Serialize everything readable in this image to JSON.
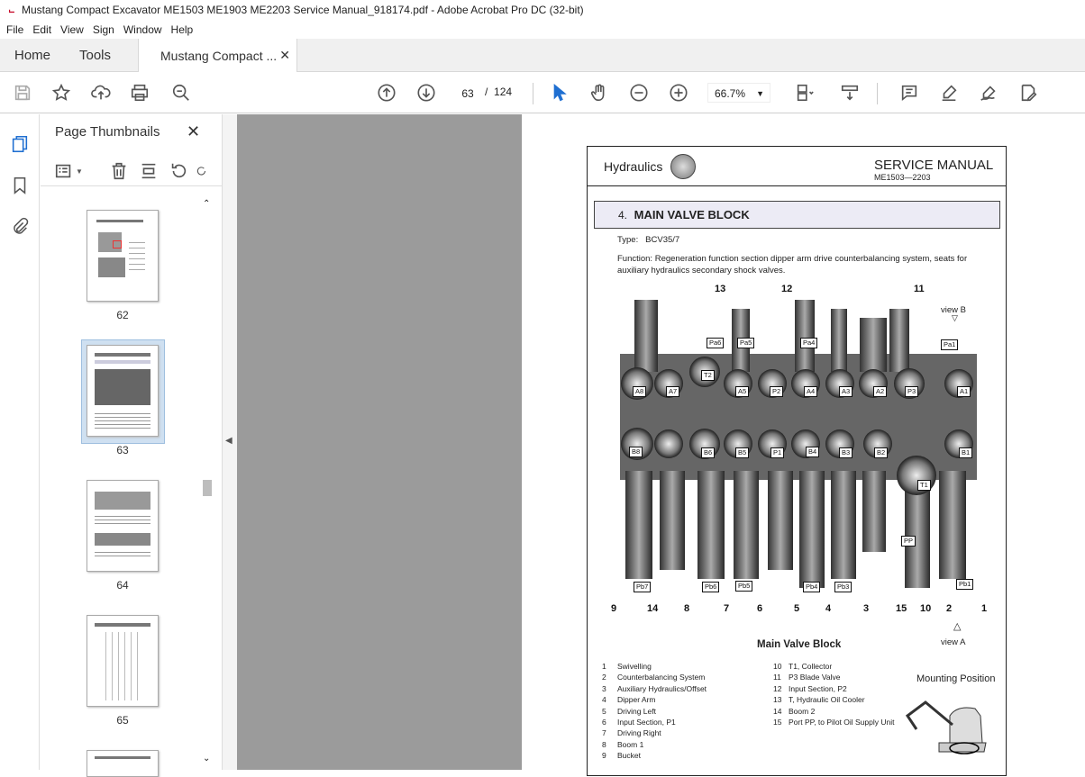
{
  "window": {
    "title": "Mustang Compact Excavator ME1503 ME1903 ME2203 Service Manual_918174.pdf - Adobe Acrobat Pro DC (32-bit)"
  },
  "menu": [
    "File",
    "Edit",
    "View",
    "Sign",
    "Window",
    "Help"
  ],
  "tabs": {
    "home": "Home",
    "tools": "Tools",
    "doc": "Mustang Compact ..."
  },
  "toolbar": {
    "page_current": "63",
    "page_sep": "/",
    "page_total": "124",
    "zoom": "66.7%"
  },
  "thumbnails": {
    "title": "Page Thumbnails",
    "pages": [
      {
        "label": "62"
      },
      {
        "label": "63"
      },
      {
        "label": "64"
      },
      {
        "label": "65"
      }
    ]
  },
  "doc": {
    "header_left": "Hydraulics",
    "header_right": "SERVICE MANUAL",
    "header_sub": "ME1503—2203",
    "section_num": "4.",
    "section_title": "MAIN VALVE BLOCK",
    "type_label": "Type:",
    "type_value": "BCV35/7",
    "function_text": "Function: Regeneration function section dipper arm drive counterbalancing system, seats for auxiliary hydraulics secondary shock valves.",
    "figure_caption": "Main Valve Block",
    "view_a": "view A",
    "view_b": "view B",
    "mounting": "Mounting Position",
    "top_callouts": [
      "13",
      "12",
      "11"
    ],
    "bottom_callouts": [
      "9",
      "14",
      "8",
      "7",
      "6",
      "5",
      "4",
      "3",
      "15",
      "10",
      "2",
      "1"
    ],
    "port_labels_top": [
      "Pa6",
      "Pa5",
      "Pa4",
      "Pa1"
    ],
    "port_labels_row1": [
      "A8",
      "A7",
      "T2",
      "A5",
      "P2",
      "A4",
      "A3",
      "A2",
      "P3",
      "A1"
    ],
    "port_labels_row2": [
      "B8",
      "B6",
      "B5",
      "P1",
      "B4",
      "B3",
      "B2",
      "B1"
    ],
    "port_labels_low": [
      "T1",
      "PP"
    ],
    "port_labels_bottom": [
      "Pb7",
      "Pb6",
      "Pb5",
      "Pb4",
      "Pb3",
      "Pb1"
    ],
    "legend_left": [
      {
        "n": "1",
        "t": "Swivelling"
      },
      {
        "n": "2",
        "t": "Counterbalancing  System"
      },
      {
        "n": "3",
        "t": "Auxiliary Hydraulics/Offset"
      },
      {
        "n": "4",
        "t": "Dipper Arm"
      },
      {
        "n": "5",
        "t": "Driving Left"
      },
      {
        "n": "6",
        "t": "Input Section, P1"
      },
      {
        "n": "7",
        "t": "Driving  Right"
      },
      {
        "n": "8",
        "t": "Boom 1"
      },
      {
        "n": "9",
        "t": "Bucket"
      }
    ],
    "legend_right": [
      {
        "n": "10",
        "t": "T1,  Collector"
      },
      {
        "n": "11",
        "t": "P3  Blade Valve"
      },
      {
        "n": "12",
        "t": "Input Section, P2"
      },
      {
        "n": "13",
        "t": "T, Hydraulic Oil Cooler"
      },
      {
        "n": "14",
        "t": "Boom 2"
      },
      {
        "n": "15",
        "t": "Port PP,  to Pilot Oil Supply Unit"
      }
    ]
  }
}
